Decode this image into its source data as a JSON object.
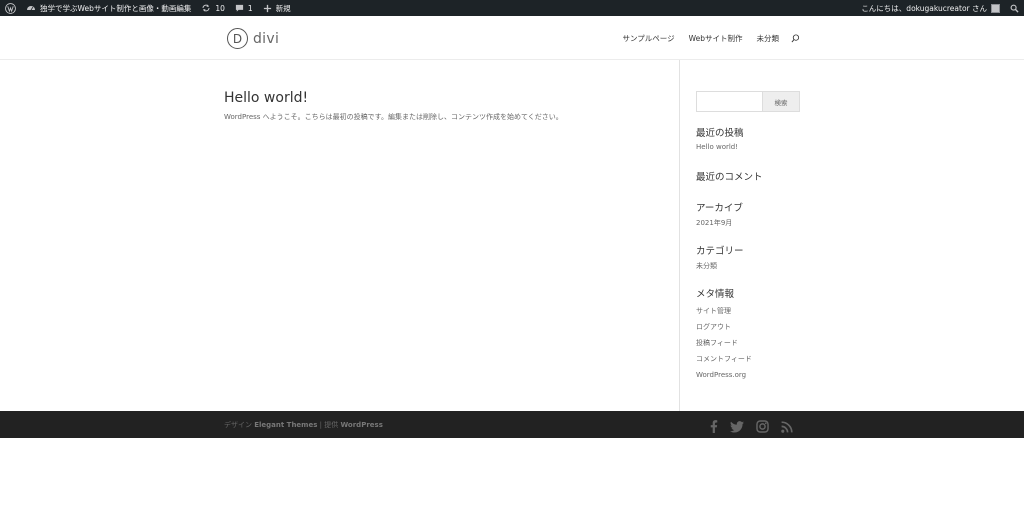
{
  "admin_bar": {
    "site_name": "独学で学ぶWebサイト制作と画像・動画編集",
    "updates_count": "10",
    "comments_count": "1",
    "new_label": "新規",
    "greeting": "こんにちは、dokugakucreator さん"
  },
  "header": {
    "logo_letter": "D",
    "logo_text": "divi",
    "nav": [
      "サンプルページ",
      "Webサイト制作",
      "未分類"
    ]
  },
  "post": {
    "title": "Hello world!",
    "body": "WordPress へようこそ。こちらは最初の投稿です。編集または削除し、コンテンツ作成を始めてください。"
  },
  "sidebar": {
    "search_button": "検索",
    "recent_posts_title": "最近の投稿",
    "recent_posts": [
      "Hello world!"
    ],
    "recent_comments_title": "最近のコメント",
    "archives_title": "アーカイブ",
    "archives": [
      "2021年9月"
    ],
    "categories_title": "カテゴリー",
    "categories": [
      "未分類"
    ],
    "meta_title": "メタ情報",
    "meta": [
      "サイト管理",
      "ログアウト",
      "投稿フィード",
      "コメントフィード",
      "WordPress.org"
    ]
  },
  "footer": {
    "design_label": "デザイン",
    "theme_name": "Elegant Themes",
    "separator": "|",
    "powered_label": "提供",
    "platform_name": "WordPress",
    "social_icons": [
      "facebook-icon",
      "twitter-icon",
      "instagram-icon",
      "rss-icon"
    ]
  },
  "colors": {
    "admin_bar_bg": "#1d2327",
    "footer_bg": "#222222",
    "text": "#666666",
    "heading": "#333333"
  }
}
